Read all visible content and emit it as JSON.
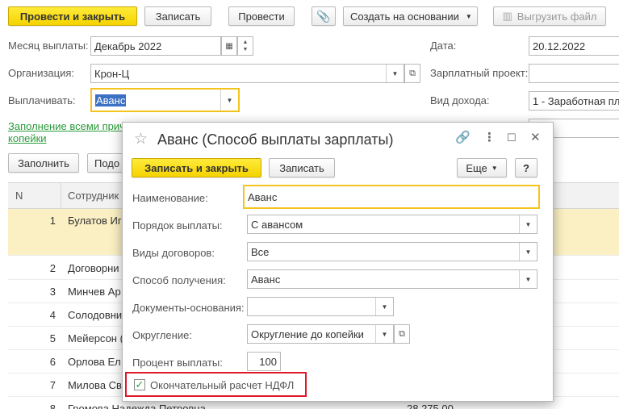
{
  "toolbar": {
    "post_close": "Провести и закрыть",
    "save": "Записать",
    "post": "Провести",
    "create_based": "Создать на основании",
    "export_file": "Выгрузить файл"
  },
  "form": {
    "month_label": "Месяц выплаты:",
    "month_value": "Декабрь 2022",
    "date_label": "Дата:",
    "date_value": "20.12.2022",
    "org_label": "Организация:",
    "org_value": "Крон-Ц",
    "salary_project_label": "Зарплатный проект:",
    "pay_label": "Выплачивать:",
    "pay_value": "Аванс",
    "income_label": "Вид дохода:",
    "income_value": "1 - Заработная пла",
    "fill_link_line1": "Заполнение всеми прич",
    "fill_link_line2": "копейки",
    "fill_button": "Заполнить",
    "pick_button": "Подо"
  },
  "table": {
    "col_n": "N",
    "col_employee": "Сотрудник",
    "rows": [
      {
        "n": "1",
        "employee": "Булатов Иг",
        "amount": ""
      },
      {
        "n": "2",
        "employee": "Договорни",
        "amount": ""
      },
      {
        "n": "3",
        "employee": "Минчев Ар",
        "amount": ""
      },
      {
        "n": "4",
        "employee": "Солодовни",
        "amount": ""
      },
      {
        "n": "5",
        "employee": "Мейерсон (",
        "amount": ""
      },
      {
        "n": "6",
        "employee": "Орлова Ел",
        "amount": ""
      },
      {
        "n": "7",
        "employee": "Милова Св",
        "amount": ""
      },
      {
        "n": "8",
        "employee": "Громова Надежда Петровна",
        "amount": "28 275,00"
      }
    ]
  },
  "dialog": {
    "title": "Аванс (Способ выплаты зарплаты)",
    "save_close": "Записать и закрыть",
    "save": "Записать",
    "more": "Еще",
    "help": "?",
    "name_label": "Наименование:",
    "name_value": "Аванс",
    "order_label": "Порядок выплаты:",
    "order_value": "С авансом",
    "contracts_label": "Виды договоров:",
    "contracts_value": "Все",
    "method_label": "Способ получения:",
    "method_value": "Аванс",
    "docs_label": "Документы-основания:",
    "docs_value": "",
    "rounding_label": "Округление:",
    "rounding_value": "Округление до копейки",
    "percent_label": "Процент выплаты:",
    "percent_value": "100",
    "ndfl_label": "Окончательный расчет НДФЛ",
    "ndfl_checked": true
  },
  "colors": {
    "accent_yellow": "#f5d300",
    "link_green": "#2a9a3a",
    "highlight_red": "#e0192a",
    "selected_row": "#fbf0c4"
  }
}
